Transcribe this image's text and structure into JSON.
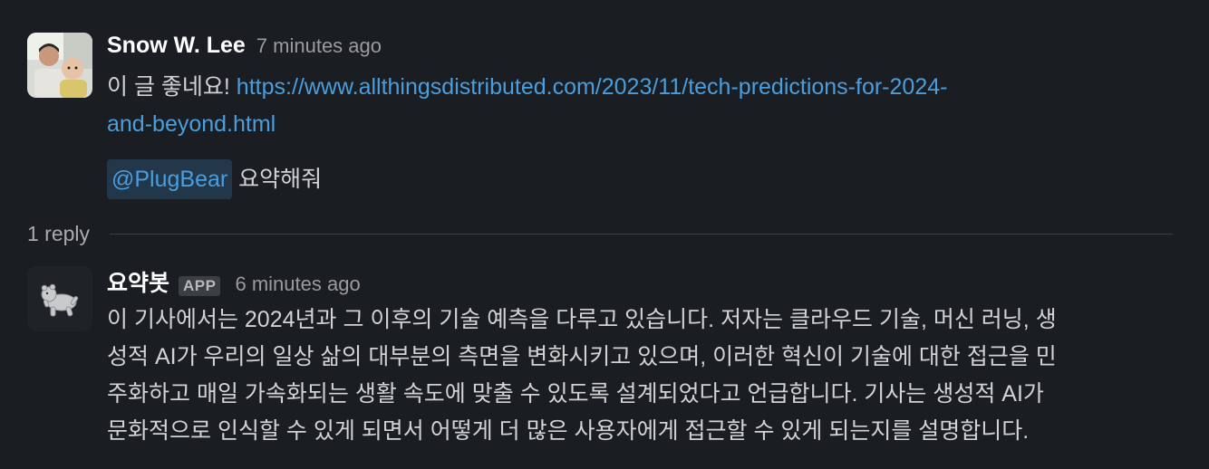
{
  "message1": {
    "author": "Snow W. Lee",
    "time": "7 minutes ago",
    "text_prefix": "이 글 좋네요! ",
    "link_line1": "https://www.allthingsdistributed.com/2023/11/tech-predictions-for-2024-",
    "link_line2": "and-beyond.html",
    "mention": "@PlugBear",
    "mention_suffix": " 요약해줘"
  },
  "thread": {
    "reply_count": "1 reply"
  },
  "message2": {
    "author": "요약봇",
    "badge": "APP",
    "time": "6 minutes ago",
    "lines": [
      "이 기사에서는 2024년과 그 이후의 기술 예측을 다루고 있습니다. 저자는 클라우드 기술, 머신 러닝, 생",
      "성적 AI가 우리의 일상 삶의 대부분의 측면을 변화시키고 있으며, 이러한 혁신이 기술에 대한 접근을 민",
      "주화하고 매일 가속화되는 생활 속도에 맞출 수 있도록 설계되었다고 언급합니다. 기사는 생성적 AI가",
      "문화적으로 인식할 수 있게 되면서 어떻게 더 많은 사용자에게 접근할 수 있게 되는지를 설명합니다."
    ]
  },
  "colors": {
    "background": "#1a1d21",
    "link": "#4a9ede",
    "mention_bg": "#22374a",
    "text": "#d1d2d3",
    "muted": "#9a9b9e"
  }
}
